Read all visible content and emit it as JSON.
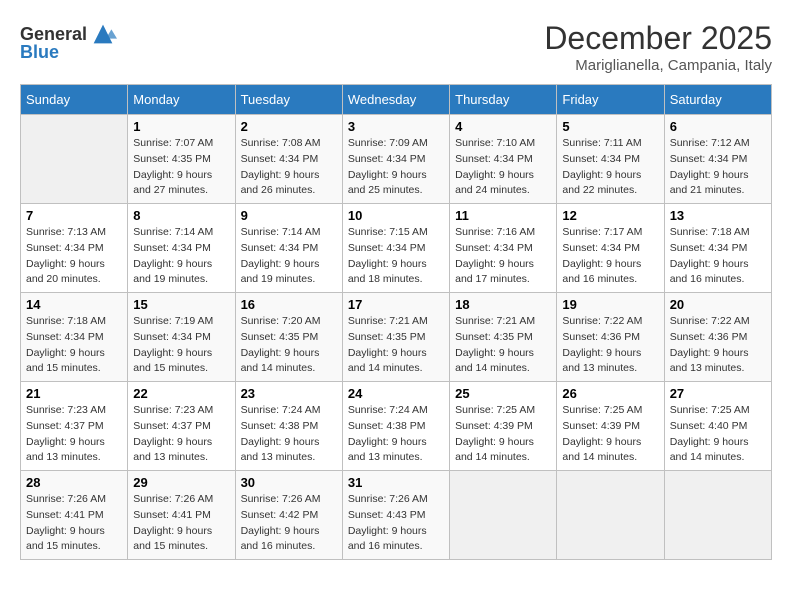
{
  "header": {
    "logo_general": "General",
    "logo_blue": "Blue",
    "month": "December 2025",
    "location": "Mariglianella, Campania, Italy"
  },
  "days_of_week": [
    "Sunday",
    "Monday",
    "Tuesday",
    "Wednesday",
    "Thursday",
    "Friday",
    "Saturday"
  ],
  "weeks": [
    [
      {
        "day": "",
        "sunrise": "",
        "sunset": "",
        "daylight": ""
      },
      {
        "day": "1",
        "sunrise": "7:07 AM",
        "sunset": "4:35 PM",
        "daylight": "9 hours and 27 minutes."
      },
      {
        "day": "2",
        "sunrise": "7:08 AM",
        "sunset": "4:34 PM",
        "daylight": "9 hours and 26 minutes."
      },
      {
        "day": "3",
        "sunrise": "7:09 AM",
        "sunset": "4:34 PM",
        "daylight": "9 hours and 25 minutes."
      },
      {
        "day": "4",
        "sunrise": "7:10 AM",
        "sunset": "4:34 PM",
        "daylight": "9 hours and 24 minutes."
      },
      {
        "day": "5",
        "sunrise": "7:11 AM",
        "sunset": "4:34 PM",
        "daylight": "9 hours and 22 minutes."
      },
      {
        "day": "6",
        "sunrise": "7:12 AM",
        "sunset": "4:34 PM",
        "daylight": "9 hours and 21 minutes."
      }
    ],
    [
      {
        "day": "7",
        "sunrise": "7:13 AM",
        "sunset": "4:34 PM",
        "daylight": "9 hours and 20 minutes."
      },
      {
        "day": "8",
        "sunrise": "7:14 AM",
        "sunset": "4:34 PM",
        "daylight": "9 hours and 19 minutes."
      },
      {
        "day": "9",
        "sunrise": "7:14 AM",
        "sunset": "4:34 PM",
        "daylight": "9 hours and 19 minutes."
      },
      {
        "day": "10",
        "sunrise": "7:15 AM",
        "sunset": "4:34 PM",
        "daylight": "9 hours and 18 minutes."
      },
      {
        "day": "11",
        "sunrise": "7:16 AM",
        "sunset": "4:34 PM",
        "daylight": "9 hours and 17 minutes."
      },
      {
        "day": "12",
        "sunrise": "7:17 AM",
        "sunset": "4:34 PM",
        "daylight": "9 hours and 16 minutes."
      },
      {
        "day": "13",
        "sunrise": "7:18 AM",
        "sunset": "4:34 PM",
        "daylight": "9 hours and 16 minutes."
      }
    ],
    [
      {
        "day": "14",
        "sunrise": "7:18 AM",
        "sunset": "4:34 PM",
        "daylight": "9 hours and 15 minutes."
      },
      {
        "day": "15",
        "sunrise": "7:19 AM",
        "sunset": "4:34 PM",
        "daylight": "9 hours and 15 minutes."
      },
      {
        "day": "16",
        "sunrise": "7:20 AM",
        "sunset": "4:35 PM",
        "daylight": "9 hours and 14 minutes."
      },
      {
        "day": "17",
        "sunrise": "7:21 AM",
        "sunset": "4:35 PM",
        "daylight": "9 hours and 14 minutes."
      },
      {
        "day": "18",
        "sunrise": "7:21 AM",
        "sunset": "4:35 PM",
        "daylight": "9 hours and 14 minutes."
      },
      {
        "day": "19",
        "sunrise": "7:22 AM",
        "sunset": "4:36 PM",
        "daylight": "9 hours and 13 minutes."
      },
      {
        "day": "20",
        "sunrise": "7:22 AM",
        "sunset": "4:36 PM",
        "daylight": "9 hours and 13 minutes."
      }
    ],
    [
      {
        "day": "21",
        "sunrise": "7:23 AM",
        "sunset": "4:37 PM",
        "daylight": "9 hours and 13 minutes."
      },
      {
        "day": "22",
        "sunrise": "7:23 AM",
        "sunset": "4:37 PM",
        "daylight": "9 hours and 13 minutes."
      },
      {
        "day": "23",
        "sunrise": "7:24 AM",
        "sunset": "4:38 PM",
        "daylight": "9 hours and 13 minutes."
      },
      {
        "day": "24",
        "sunrise": "7:24 AM",
        "sunset": "4:38 PM",
        "daylight": "9 hours and 13 minutes."
      },
      {
        "day": "25",
        "sunrise": "7:25 AM",
        "sunset": "4:39 PM",
        "daylight": "9 hours and 14 minutes."
      },
      {
        "day": "26",
        "sunrise": "7:25 AM",
        "sunset": "4:39 PM",
        "daylight": "9 hours and 14 minutes."
      },
      {
        "day": "27",
        "sunrise": "7:25 AM",
        "sunset": "4:40 PM",
        "daylight": "9 hours and 14 minutes."
      }
    ],
    [
      {
        "day": "28",
        "sunrise": "7:26 AM",
        "sunset": "4:41 PM",
        "daylight": "9 hours and 15 minutes."
      },
      {
        "day": "29",
        "sunrise": "7:26 AM",
        "sunset": "4:41 PM",
        "daylight": "9 hours and 15 minutes."
      },
      {
        "day": "30",
        "sunrise": "7:26 AM",
        "sunset": "4:42 PM",
        "daylight": "9 hours and 16 minutes."
      },
      {
        "day": "31",
        "sunrise": "7:26 AM",
        "sunset": "4:43 PM",
        "daylight": "9 hours and 16 minutes."
      },
      {
        "day": "",
        "sunrise": "",
        "sunset": "",
        "daylight": ""
      },
      {
        "day": "",
        "sunrise": "",
        "sunset": "",
        "daylight": ""
      },
      {
        "day": "",
        "sunrise": "",
        "sunset": "",
        "daylight": ""
      }
    ]
  ],
  "labels": {
    "sunrise_prefix": "Sunrise: ",
    "sunset_prefix": "Sunset: ",
    "daylight_prefix": "Daylight: "
  }
}
